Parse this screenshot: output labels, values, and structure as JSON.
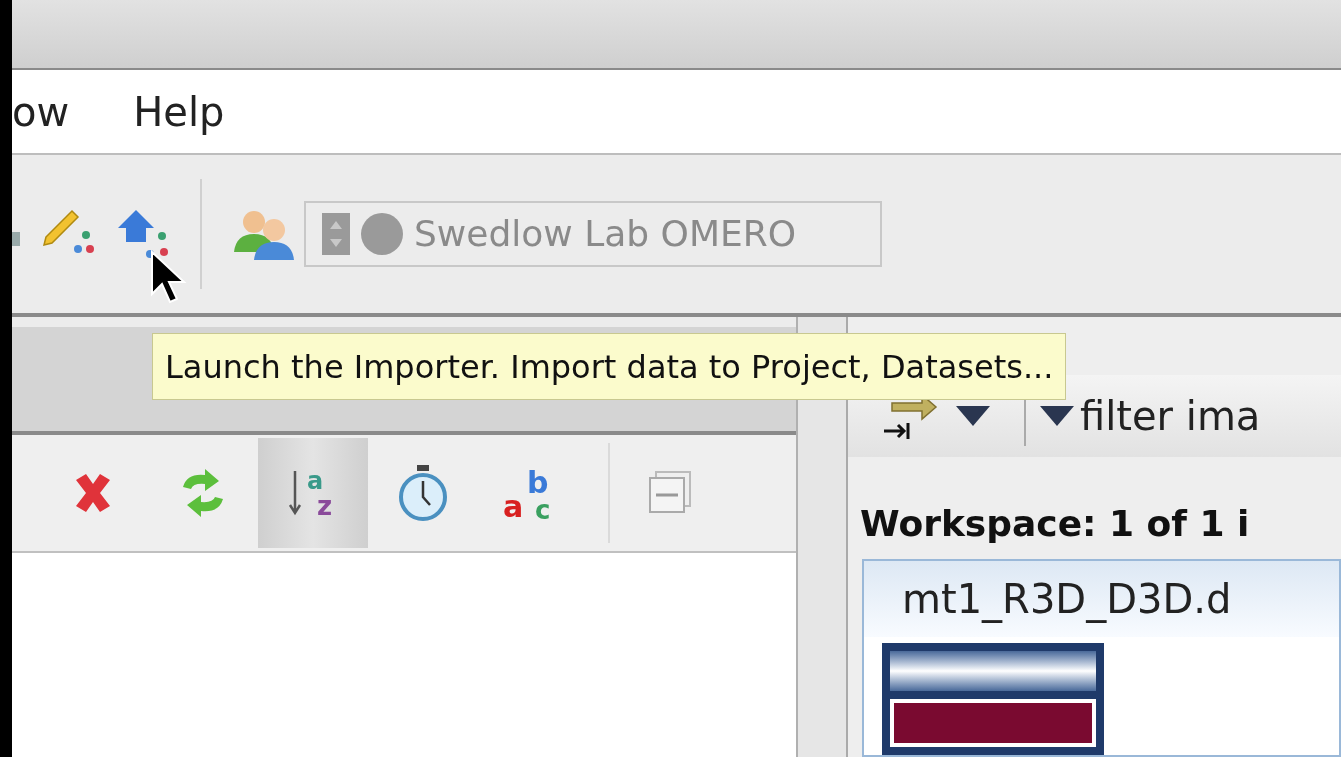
{
  "menu": [
    {
      "label": "ow"
    },
    {
      "label": "Help"
    }
  ],
  "toolbar": {
    "server": "Swedlow Lab OMERO"
  },
  "tooltip": "Launch the Importer. Import data to Project, Datasets...",
  "left_tools": [
    {
      "kind": "delete",
      "selected": false
    },
    {
      "kind": "refresh",
      "selected": false
    },
    {
      "kind": "sort",
      "selected": true,
      "glyphs": [
        "a",
        "z"
      ]
    },
    {
      "kind": "clock",
      "selected": false
    },
    {
      "kind": "letters",
      "selected": false,
      "glyphs": [
        "b",
        "a",
        "c"
      ]
    }
  ],
  "right_panel": {
    "filter": "filter ima",
    "workspace": "Workspace: 1 of 1 i",
    "thumbnail_title": "mt1_R3D_D3D.d"
  }
}
